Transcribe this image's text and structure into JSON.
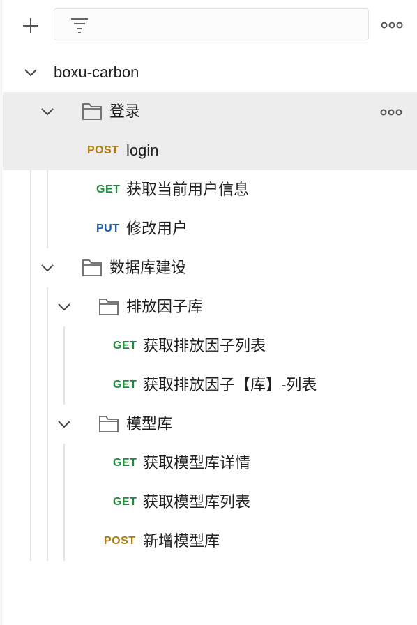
{
  "toolbar": {
    "add_icon": "plus-icon",
    "filter_icon": "filter-icon",
    "more_icon": "more-icon"
  },
  "project": {
    "name": "boxu-carbon"
  },
  "groups": {
    "login": {
      "name": "登录",
      "items": [
        {
          "method": "POST",
          "name": "login"
        },
        {
          "method": "GET",
          "name": "获取当前用户信息"
        },
        {
          "method": "PUT",
          "name": "修改用户"
        }
      ]
    },
    "database": {
      "name": "数据库建设",
      "sub": {
        "emission": {
          "name": "排放因子库",
          "items": [
            {
              "method": "GET",
              "name": "获取排放因子列表"
            },
            {
              "method": "GET",
              "name": "获取排放因子【库】-列表"
            }
          ]
        },
        "model": {
          "name": "模型库",
          "items": [
            {
              "method": "GET",
              "name": "获取模型库详情"
            },
            {
              "method": "GET",
              "name": "获取模型库列表"
            }
          ]
        }
      },
      "items": [
        {
          "method": "POST",
          "name": "新增模型库"
        }
      ]
    }
  },
  "colors": {
    "get": "#1e8a3b",
    "post": "#b27a0b",
    "put": "#1a5fb4",
    "selected_bg": "#ededed"
  }
}
